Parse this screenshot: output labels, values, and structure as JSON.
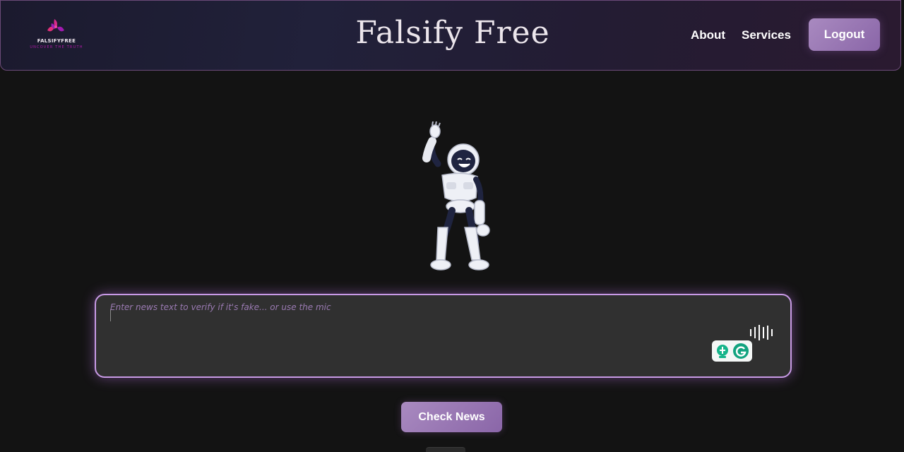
{
  "header": {
    "logo_text": "FALSIFYFREE",
    "logo_tagline": "UNCOVER THE TRUTH",
    "title": "Falsify Free",
    "nav": {
      "about": "About",
      "services": "Services"
    },
    "logout_label": "Logout"
  },
  "main": {
    "hero_image": "waving-robot-illustration",
    "news_input": {
      "value": "",
      "placeholder": "Enter news text to verify if it's fake... or use the mic"
    },
    "mic_icon": "mic-waveform-icon",
    "grammarly_icon": "grammarly-icon",
    "check_label": "Check News"
  },
  "colors": {
    "accent": "#a98ac0",
    "border_glow": "#c89ae6",
    "background": "#131313",
    "input_bg": "#303030",
    "placeholder": "#9a7ab2"
  }
}
